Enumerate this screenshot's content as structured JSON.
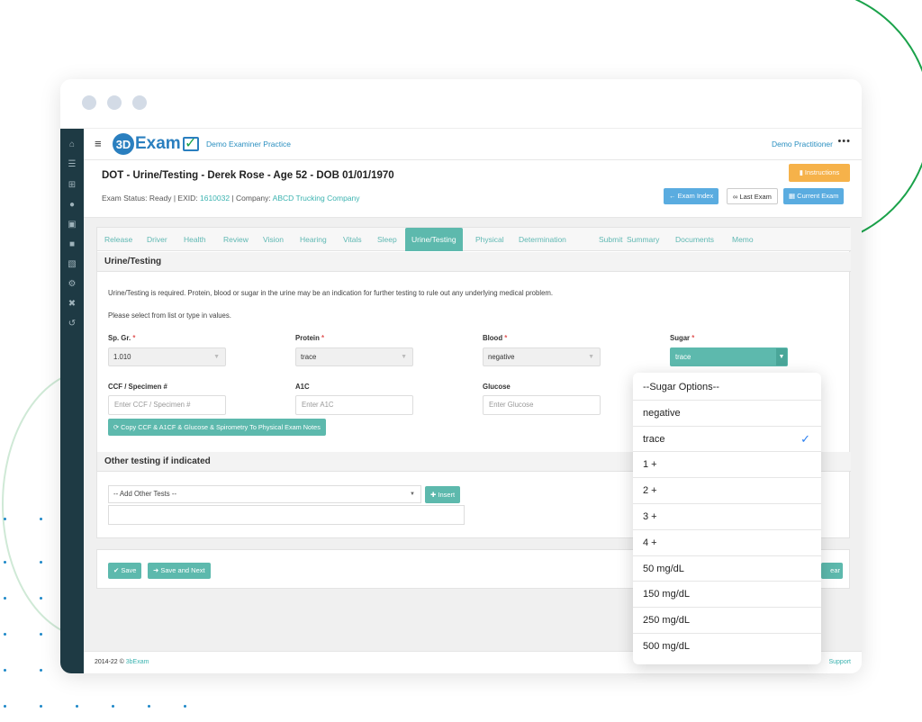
{
  "window": {
    "dots": 3
  },
  "app": {
    "logo_mark": "3D",
    "logo_text": "Exam",
    "practice": "Demo Examiner Practice",
    "practitioner": "Demo Practitioner",
    "more": "•••"
  },
  "exam": {
    "title": "DOT - Urine/Testing - Derek Rose - Age 52 - DOB 01/01/1970",
    "status_prefix": "Exam Status: Ready | EXID: ",
    "exid": "1610032",
    "company_prefix": " | Company: ",
    "company": "ABCD Trucking Company",
    "instructions_label": "Instructions",
    "exam_index_label": "Exam Index",
    "last_exam_label": "Last Exam",
    "current_exam_label": "Current Exam"
  },
  "tabs": [
    "Release",
    "Driver",
    "Health",
    "Review",
    "Vision",
    "Hearing",
    "Vitals",
    "Sleep",
    "Urine/Testing",
    "Physical",
    "Determination",
    "Submit",
    "Summary",
    "Documents",
    "Memo"
  ],
  "active_tab": "Urine/Testing",
  "urine": {
    "heading": "Urine/Testing",
    "note1": "Urine/Testing is required. Protein, blood or sugar in the urine may be an indication for further testing to rule out any underlying medical problem.",
    "note2": "Please select from list or type in values.",
    "sp_gr_label": "Sp. Gr.",
    "sp_gr_value": "1.010",
    "protein_label": "Protein",
    "protein_value": "trace",
    "blood_label": "Blood",
    "blood_value": "negative",
    "sugar_label": "Sugar",
    "sugar_value": "trace",
    "req_mark": "*",
    "ccf_label": "CCF / Specimen #",
    "ccf_placeholder": "Enter CCF / Specimen #",
    "a1c_label": "A1C",
    "a1c_placeholder": "Enter A1C",
    "glucose_label": "Glucose",
    "glucose_placeholder": "Enter Glucose",
    "copy_button": "Copy CCF & A1CF & Glucose & Spirometry To Physical Exam Notes"
  },
  "other": {
    "heading": "Other testing if indicated",
    "select_value": "-- Add Other Tests --",
    "insert_label": "Insert"
  },
  "actions": {
    "save_label": "Save",
    "save_next_label": "Save and Next",
    "clear_label": "ear"
  },
  "footer": {
    "copyright_prefix": "2014-22 © ",
    "copyright_link": "3bExam",
    "support": "Support"
  },
  "sugar_dropdown": {
    "options": [
      "--Sugar Options--",
      "negative",
      "trace",
      "1 +",
      "2 +",
      "3 +",
      "4 +",
      "50 mg/dL",
      "150 mg/dL",
      "250 mg/dL",
      "500 mg/dL"
    ],
    "selected": "trace"
  },
  "colors": {
    "accent": "#5db9ad",
    "link": "#2a8fc0",
    "rail": "#1e3a44",
    "instructions": "#f6b24a",
    "check": "#2a7ff0"
  },
  "icons": {
    "rail": [
      "home-icon",
      "list-icon",
      "plus-square-icon",
      "user-icon",
      "truck-icon",
      "folder-icon",
      "bar-chart-icon",
      "gear-icon",
      "tools-icon",
      "logout-icon"
    ]
  }
}
